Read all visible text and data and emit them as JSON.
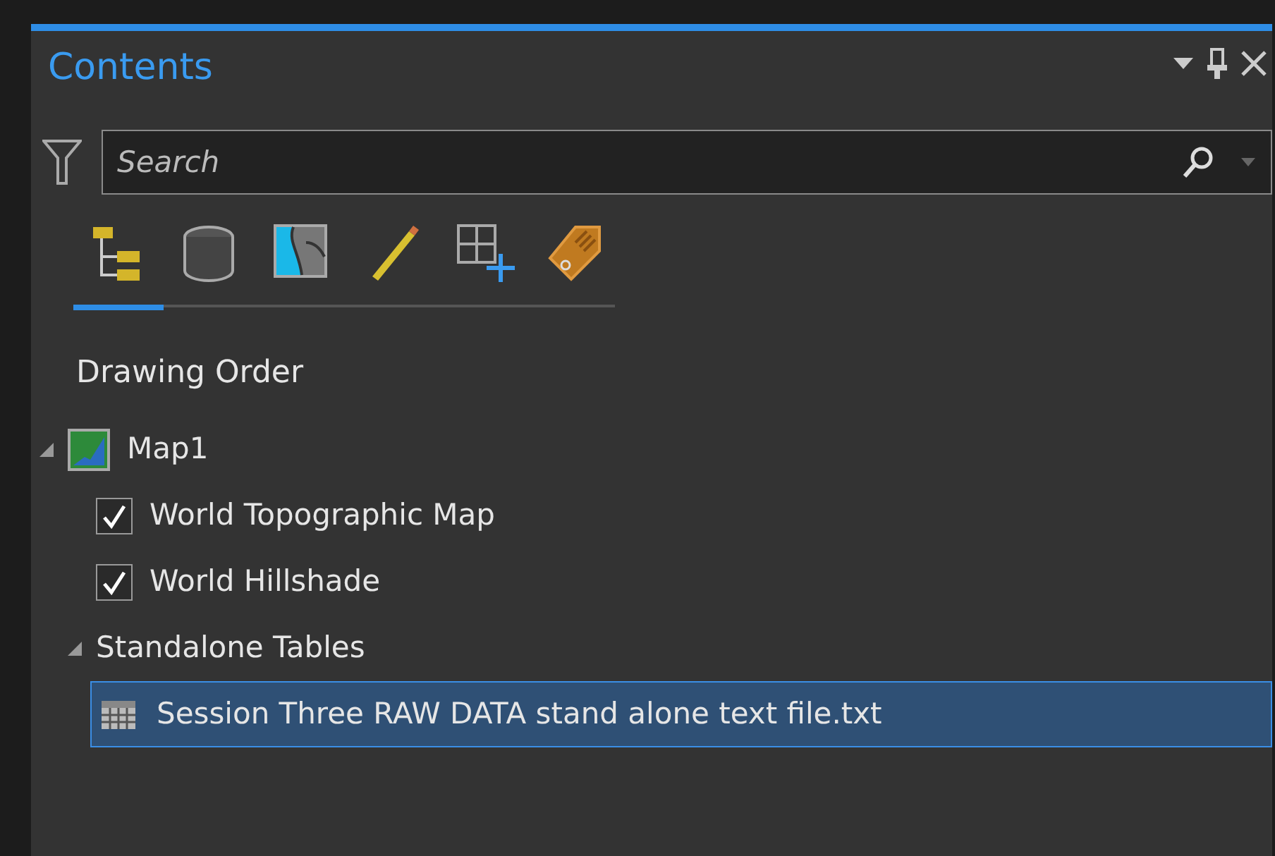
{
  "panel": {
    "title": "Contents"
  },
  "search": {
    "placeholder": "Search"
  },
  "view_tabs": [
    {
      "kind": "drawing-order",
      "selected": true
    },
    {
      "kind": "source",
      "selected": false
    },
    {
      "kind": "selection",
      "selected": false
    },
    {
      "kind": "editing",
      "selected": false
    },
    {
      "kind": "snapping",
      "selected": false
    },
    {
      "kind": "labeling",
      "selected": false
    }
  ],
  "section_title": "Drawing Order",
  "tree": [
    {
      "label": "Map1",
      "kind": "map",
      "expanded": true,
      "children": [
        {
          "label": "World Topographic Map",
          "kind": "layer",
          "checked": true
        },
        {
          "label": "World Hillshade",
          "kind": "layer",
          "checked": true
        }
      ]
    },
    {
      "label": "Standalone Tables",
      "kind": "group",
      "expanded": true,
      "children": [
        {
          "label": "Session Three RAW DATA stand alone text file.txt",
          "kind": "table",
          "selected": true
        }
      ]
    }
  ]
}
